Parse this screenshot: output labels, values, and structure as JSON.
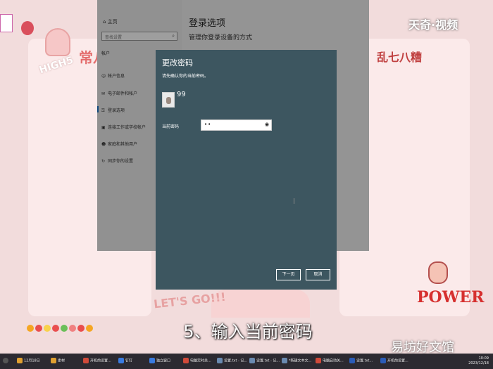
{
  "wallpaper": {
    "high5": "HIGH5",
    "deco_left": "常八",
    "deco_right": "乱七八糟",
    "letsgo": "LET'S GO!!!",
    "power": "POWER",
    "watermark_top": "天奇·视频",
    "dots": [
      "#f5a623",
      "#e94e4e",
      "#f8d24b",
      "#e94e4e",
      "#6bbf59",
      "#f08080",
      "#e94e4e",
      "#f5a623"
    ]
  },
  "settings": {
    "nav": {
      "home": "主页",
      "search_placeholder": "查找设置",
      "section": "帐户",
      "items": [
        {
          "icon": "☺",
          "label": "帐户信息"
        },
        {
          "icon": "✉",
          "label": "电子邮件和帐户"
        },
        {
          "icon": "⚿",
          "label": "登录选项"
        },
        {
          "icon": "▣",
          "label": "连接工作或学校帐户"
        },
        {
          "icon": "☻",
          "label": "家庭和其他用户"
        },
        {
          "icon": "↻",
          "label": "同步你的设置"
        }
      ]
    },
    "main": {
      "title": "登录选项",
      "subtitle": "管理你登录设备的方式"
    }
  },
  "dialog": {
    "title": "更改密码",
    "instruction": "请先确认你的当前密码。",
    "account_name": "99",
    "password_label": "当前密码",
    "password_value": "••",
    "next_button": "下一页",
    "cancel_button": "取消"
  },
  "subtitle": "5、输入当前密码",
  "watermark_bottom": "易坊好文馆",
  "taskbar": {
    "items": [
      {
        "label": "12月18日",
        "color": "#e0a030"
      },
      {
        "label": "素材",
        "color": "#e0a030"
      },
      {
        "label": "开机前设置...",
        "color": "#d04a3a"
      },
      {
        "label": "钉钉",
        "color": "#3a7be0"
      },
      {
        "label": "独立窗口",
        "color": "#3a7be0"
      },
      {
        "label": "电脑定时关...",
        "color": "#d04a3a"
      },
      {
        "label": "设置.txt - 记...",
        "color": "#6a8ab0"
      },
      {
        "label": "设置.txt - 记...",
        "color": "#6a8ab0"
      },
      {
        "label": "*新建文本文...",
        "color": "#6a8ab0"
      },
      {
        "label": "电脑启动关...",
        "color": "#d04a3a"
      },
      {
        "label": "设置.txt...",
        "color": "#2b5cb8"
      },
      {
        "label": "开机前设置...",
        "color": "#2b5cb8"
      }
    ],
    "clock_time": "10:09",
    "clock_date": "2023/12/18"
  }
}
